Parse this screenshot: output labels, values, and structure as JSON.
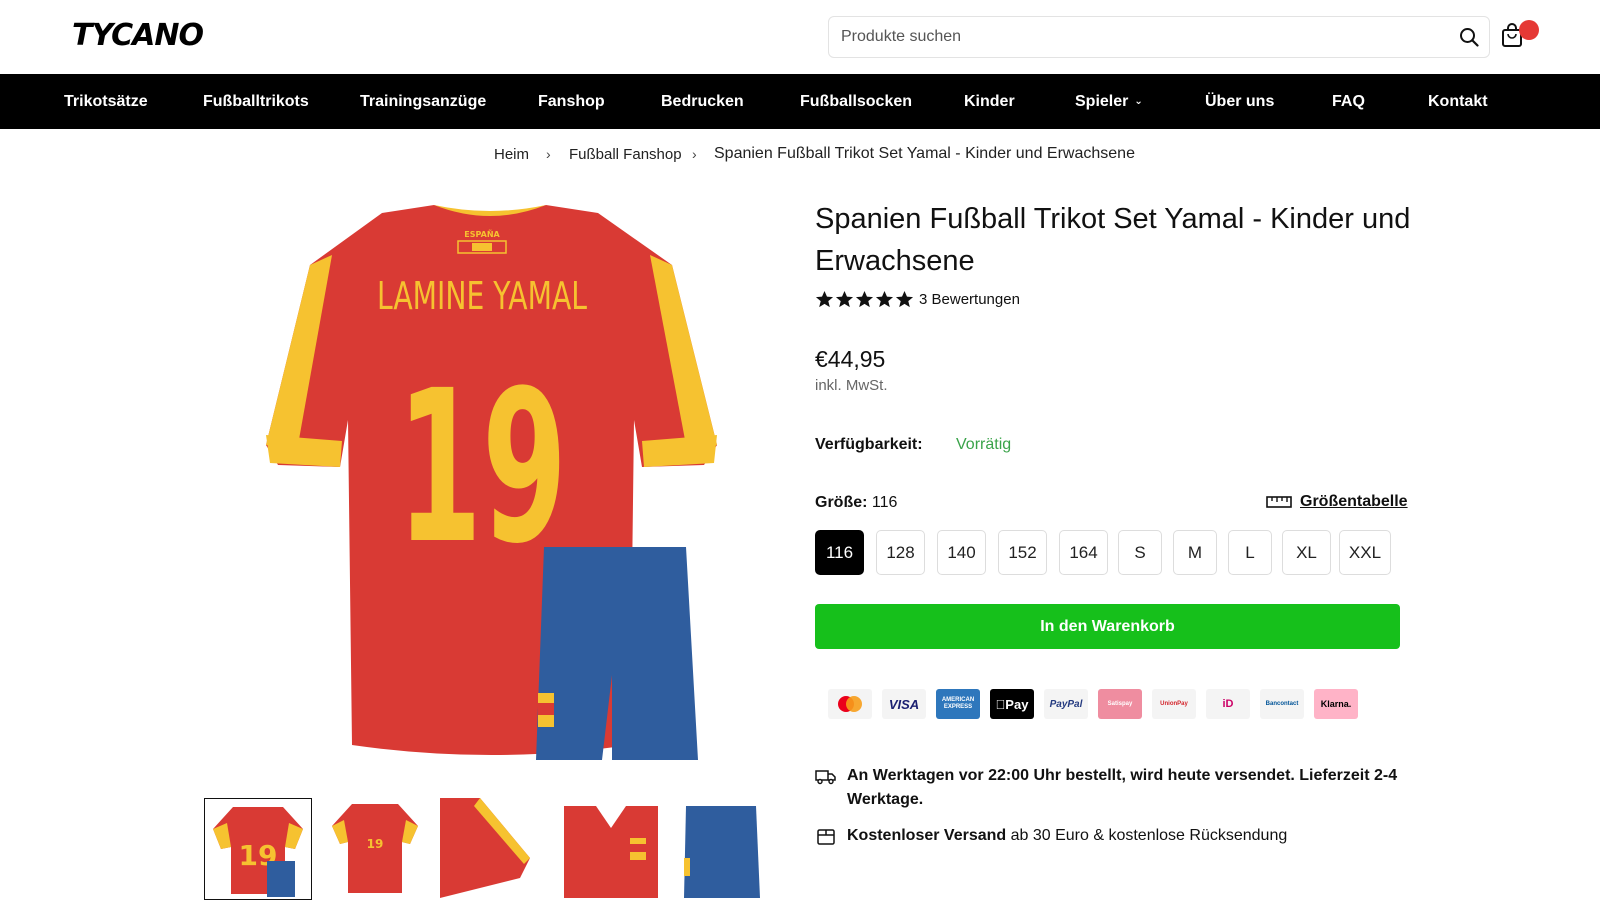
{
  "header": {
    "logo": "TYCANO",
    "search_placeholder": "Produkte suchen"
  },
  "nav": {
    "items": [
      "Trikotsätze",
      "Fußballtrikots",
      "Trainingsanzüge",
      "Fanshop",
      "Bedrucken",
      "Fußballsocken",
      "Kinder",
      "Spieler",
      "Über uns",
      "FAQ",
      "Kontakt"
    ]
  },
  "breadcrumb": {
    "home": "Heim",
    "category": "Fußball Fanshop",
    "current": "Spanien Fußball Trikot Set Yamal - Kinder und Erwachsene"
  },
  "product": {
    "title": "Spanien Fußball Trikot Set Yamal - Kinder und Erwachsene",
    "rating": 5,
    "reviews": "3 Bewertungen",
    "price": "€44,95",
    "tax": "inkl. MwSt.",
    "availability_label": "Verfügbarkeit:",
    "availability_value": "Vorrätig",
    "size_label": "Größe:",
    "size_selected": "116",
    "size_chart": "Größentabelle",
    "sizes": [
      "116",
      "128",
      "140",
      "152",
      "164",
      "S",
      "M",
      "L",
      "XL",
      "XXL"
    ],
    "add_to_cart": "In den Warenkorb",
    "jersey_name": "LAMINE YAMAL",
    "jersey_number": "19",
    "jersey_badge": "ESPAÑA"
  },
  "payments": [
    "mastercard",
    "VISA",
    "AMERICAN EXPRESS",
    "Pay",
    "PayPal",
    "Satispay",
    "UnionPay",
    "iD",
    "Bancontact",
    "Klarna."
  ],
  "shipping": {
    "line1_bold": "An Werktagen vor 22:00 Uhr bestellt, wird heute versendet. Lieferzeit 2-4 Werktage.",
    "line2_bold": "Kostenloser Versand",
    "line2_rest": " ab 30 Euro & kostenlose Rücksendung"
  },
  "colors": {
    "jersey_red": "#d93a34",
    "jersey_yellow": "#f6c230",
    "shorts_blue": "#2f5d9e",
    "cart_green": "#16c01b",
    "badge_red": "#e53935",
    "in_stock_green": "#3aa34a"
  }
}
